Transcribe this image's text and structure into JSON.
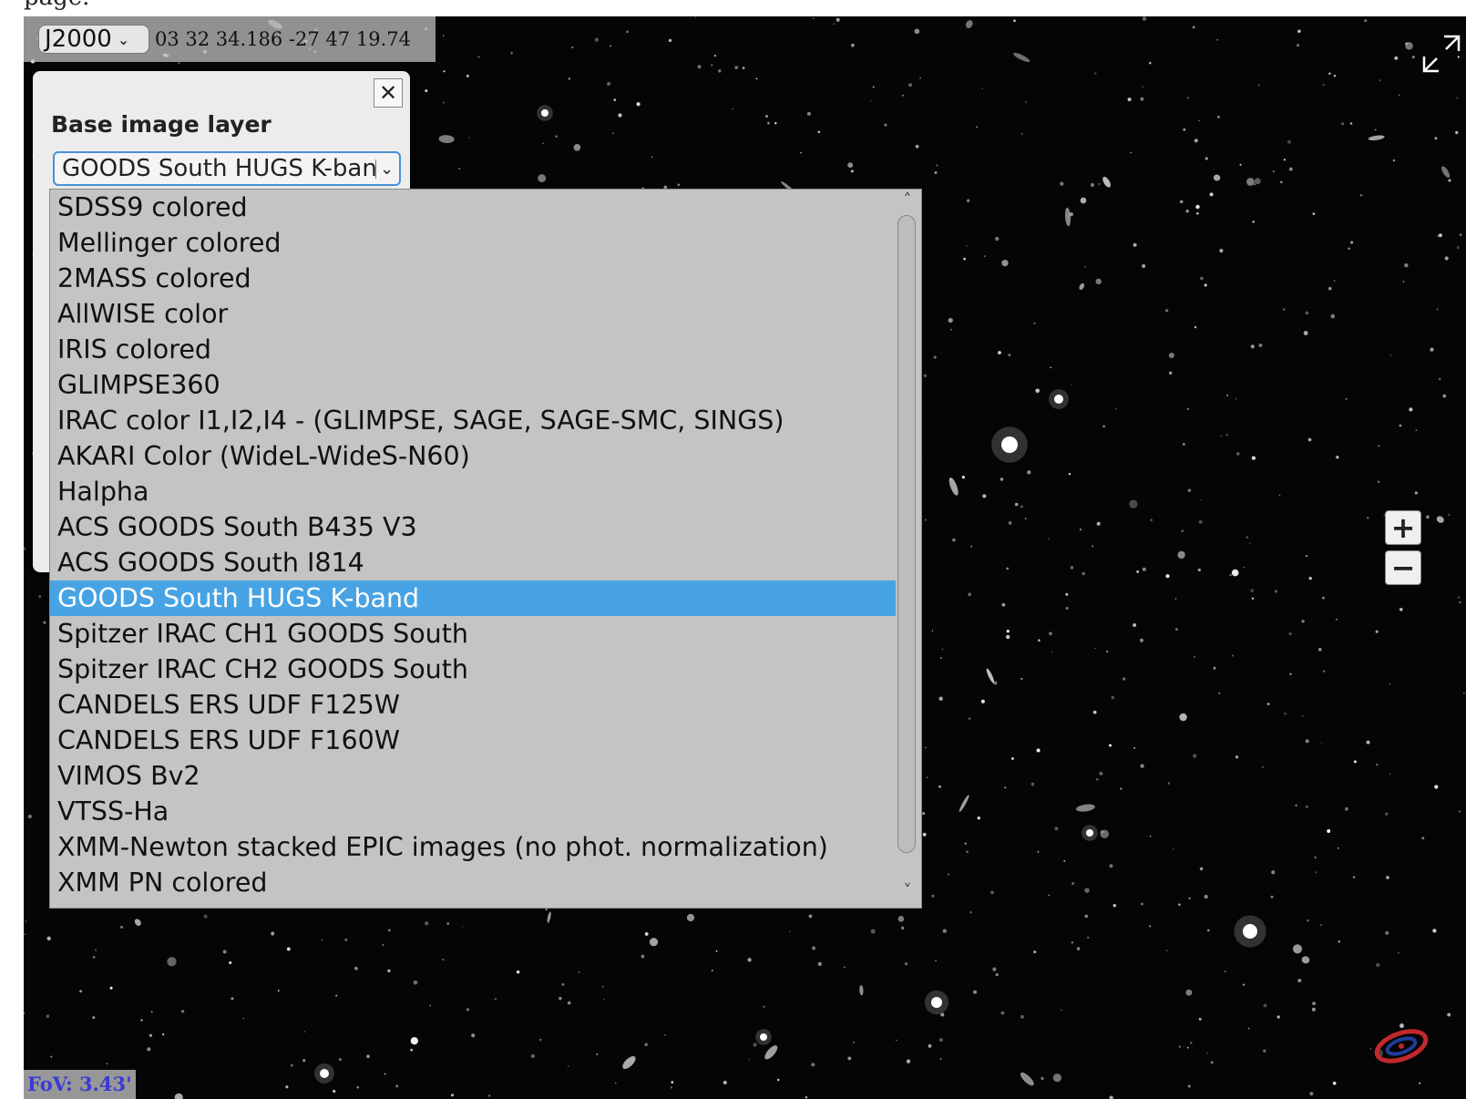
{
  "page": {
    "top_text": "page."
  },
  "coord_bar": {
    "frame": "J2000",
    "frame_icon": "chevron-down-icon",
    "coordinates": "03 32 34.186 -27 47 19.74"
  },
  "layer_panel": {
    "close_symbol": "✕",
    "title": "Base image layer",
    "selected_value": "GOODS South HUGS K-band",
    "selected_index": 11,
    "options": [
      "SDSS9 colored",
      "Mellinger colored",
      "2MASS colored",
      "AllWISE color",
      "IRIS colored",
      "GLIMPSE360",
      "IRAC color I1,I2,I4 - (GLIMPSE, SAGE, SAGE-SMC, SINGS)",
      "AKARI Color (WideL-WideS-N60)",
      "Halpha",
      "ACS GOODS South B435 V3",
      "ACS GOODS South I814",
      "GOODS South HUGS K-band",
      "Spitzer IRAC CH1 GOODS South",
      "Spitzer IRAC CH2 GOODS South",
      "CANDELS ERS UDF F125W",
      "CANDELS ERS UDF F160W",
      "VIMOS Bv2",
      "VTSS-Ha",
      "XMM-Newton stacked EPIC images (no phot. normalization)",
      "XMM PN colored"
    ]
  },
  "controls": {
    "zoom_in": "+",
    "zoom_out": "−",
    "fullscreen_icon": "fullscreen-icon"
  },
  "fov": "FoV: 3.43'",
  "colors": {
    "selected_bg": "#47a3e3",
    "fov_text": "#3a3ad6",
    "list_bg": "#c4c4c4"
  }
}
